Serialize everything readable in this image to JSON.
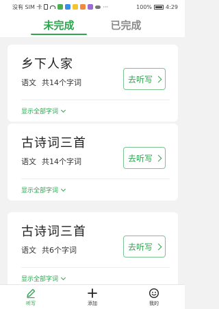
{
  "status_bar": {
    "carrier": "没有 SIM 卡",
    "battery": "100%",
    "time": "4:29"
  },
  "tabs": [
    {
      "label": "未完成",
      "active": true
    },
    {
      "label": "已完成",
      "active": false
    }
  ],
  "cards": [
    {
      "title": "乡下人家",
      "subject": "语文",
      "count": "共14个字词",
      "action": "去听写",
      "show_all": "显示全部字词"
    },
    {
      "title": "古诗词三首",
      "subject": "语文",
      "count": "共14个字词",
      "action": "去听写",
      "show_all": "显示全部字词"
    },
    {
      "title": "古诗词三首",
      "subject": "语文",
      "count": "共6个字词",
      "action": "去听写",
      "show_all": "显示全部字词"
    }
  ],
  "bottom_nav": [
    {
      "label": "听写",
      "icon": "pencil-icon",
      "active": true
    },
    {
      "label": "添加",
      "icon": "plus-icon",
      "active": false
    },
    {
      "label": "我的",
      "icon": "smiley-icon",
      "active": false
    }
  ],
  "colors": {
    "accent": "#2ea44f",
    "inactive_tab": "#8a8a8a",
    "background": "#f2f2f2"
  }
}
